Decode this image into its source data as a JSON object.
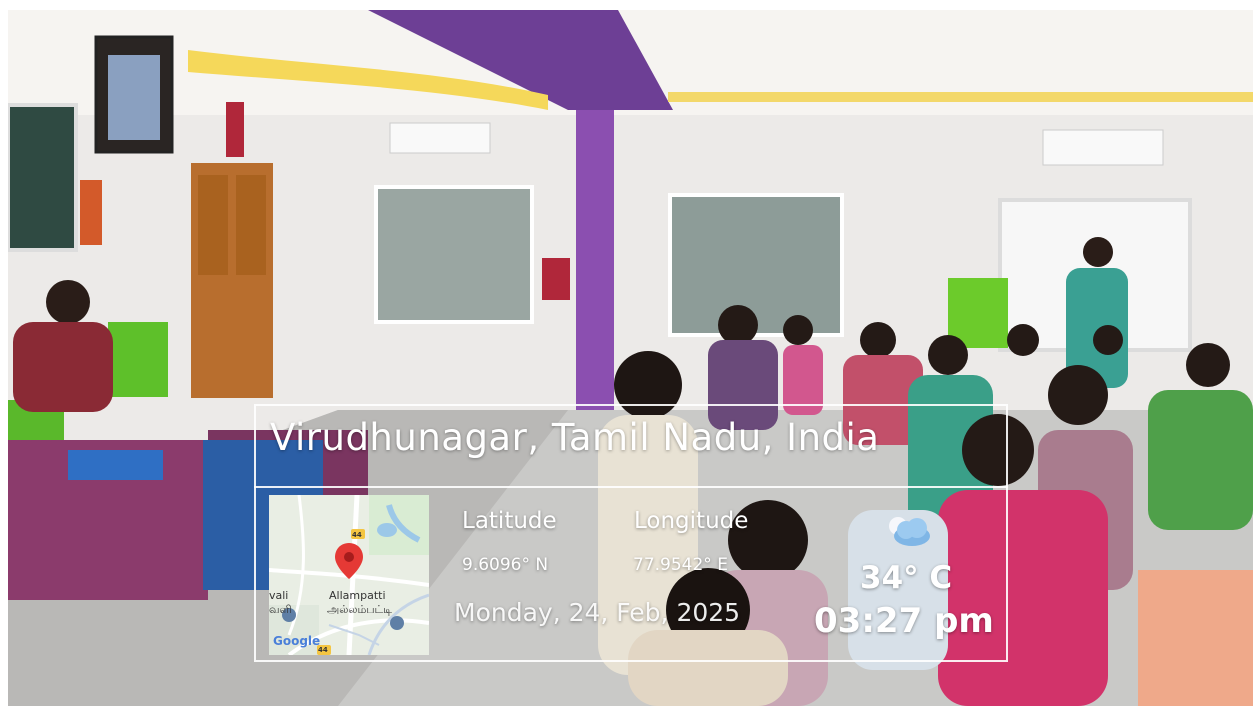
{
  "location": {
    "place": "Virudhunagar, Tamil Nadu, India",
    "latitude_label": "Latitude",
    "longitude_label": "Longitude",
    "latitude_value": "9.6096° N",
    "longitude_value": "77.9542° E",
    "date": "Monday, 24, Feb, 2025",
    "temperature": "34° C",
    "time": "03:27 pm",
    "weather_icon": "partly-cloudy-icon"
  },
  "map": {
    "place_name": "Allampatti",
    "place_name_tamil": "அல்லம்பட்டி",
    "partial_left_label": "vali",
    "partial_left_label_tamil": "வளி",
    "road_shield_top": "44",
    "road_shield_bottom": "44",
    "brand": "Google",
    "marker_icon": "map-pin-icon"
  }
}
